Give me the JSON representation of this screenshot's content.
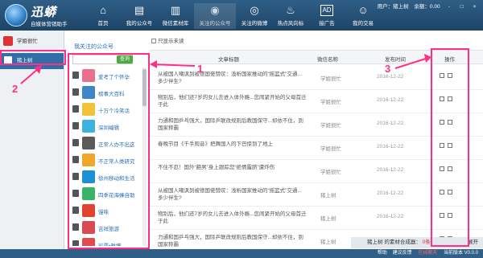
{
  "app": {
    "name": "迅蟒",
    "slogan": "自媒体营销助手"
  },
  "nav": [
    {
      "label": "首页",
      "icon": "home-icon",
      "glyph": "⌂"
    },
    {
      "label": "我的公众号",
      "icon": "doc-icon",
      "glyph": "▤"
    },
    {
      "label": "微信素材库",
      "icon": "library-icon",
      "glyph": "▥"
    },
    {
      "label": "关注的公众号",
      "icon": "wechat-icon",
      "glyph": "◉"
    },
    {
      "label": "关注的微博",
      "icon": "weibo-icon",
      "glyph": "◎"
    },
    {
      "label": "热点风向标",
      "icon": "fire-icon",
      "glyph": "♨"
    },
    {
      "label": "接广告",
      "icon": "ad-icon",
      "glyph": "AD"
    },
    {
      "label": "我的交易",
      "icon": "trade-icon",
      "glyph": "☺"
    }
  ],
  "user": {
    "label": "用户：猪上树",
    "balance": "余额：0.00",
    "min": "-",
    "max": "□",
    "close": "×"
  },
  "sidebar": {
    "accounts": [
      {
        "name": "学姐很忙",
        "selected": false
      },
      {
        "name": "猪上树",
        "selected": true
      }
    ]
  },
  "follow": {
    "title": "我关注的公众号",
    "search_label": "查询",
    "search_placeholder": "",
    "items": [
      {
        "name": "爱考了个怀孕",
        "color": "#e86f8e"
      },
      {
        "name": "榜事大百科",
        "color": "#3d86c8"
      },
      {
        "name": "十万个冷笑话",
        "color": "#f2c23a"
      },
      {
        "name": "深圳编辑",
        "color": "#3db1e0"
      },
      {
        "name": "正常人办不出这",
        "color": "#5a5a5a"
      },
      {
        "name": "不正常人类研究",
        "color": "#f0a52b"
      },
      {
        "name": "徐州移动和生活",
        "color": "#1d8fd5"
      },
      {
        "name": "四季花海蜂自助",
        "color": "#37b36a"
      },
      {
        "name": "馒味",
        "color": "#e0422f"
      },
      {
        "name": "吉祥旅游",
        "color": "#d94b52"
      },
      {
        "name": "彩票•雅博",
        "color": "#e04c4c"
      }
    ]
  },
  "main": {
    "show_unread": "只显示未读",
    "headers": {
      "title": "文章标题",
      "account": "微信名称",
      "date": "发布时间",
      "ops": "操作"
    },
    "rows": [
      {
        "title": "从被国人嘲讽到被德国佬赞叹：浅析国家推动的“摇篮式”交通...多少伴生?",
        "account": "学姐很忙",
        "date": "2016-12-22"
      },
      {
        "title": "物别后，他们还7岁的女儿去进入体外瘾...您闹紧开始的父母首迁于此",
        "account": "学姐很忙",
        "date": "2016-12-22"
      },
      {
        "title": "力通和国乒乓强大，国际乒联改规则后教国保守...却依不住，到国家称霸",
        "account": "学姐很忙",
        "date": "2016-12-22"
      },
      {
        "title": "春晚节目《千手观音》把舞国人的下巴惊到了地上",
        "account": "学姐很忙",
        "date": "2016-12-22"
      },
      {
        "title": "不住不忍！国外“葩男”身上跟踪您“绝情露脐”遭炸伤",
        "account": "学姐很忙",
        "date": "2016-12-22"
      },
      {
        "title": "从被国人嘲讽到被德国佬赞叹：浅析国家推动的“摇篮式”交通...多少伴生?",
        "account": "猪上树",
        "date": "2016-12-22"
      },
      {
        "title": "物别后，他们还7岁的女儿去进入体外瘾...您闹紧开始的父母首迁于此",
        "account": "猪上树",
        "date": "2016-12-22"
      },
      {
        "title": "力通和国乒乓强大，国际乒联改规则后教国保守...却依不住，到国家称霸",
        "account": "猪上树",
        "date": "2016-12-22"
      }
    ]
  },
  "footer": {
    "account": "猪上树",
    "text": "的素材合成器：",
    "count": "0条",
    "expand": "展开"
  },
  "status": {
    "help": "帮助",
    "feedback": "建议反馈",
    "online": "在线聊天",
    "version": "当前版本 V0.0.0"
  },
  "annotations": [
    "1",
    "2",
    "3"
  ],
  "colors": {
    "header": "#2f5e86",
    "accent": "#ff2f86",
    "link": "#2c6fb3"
  }
}
